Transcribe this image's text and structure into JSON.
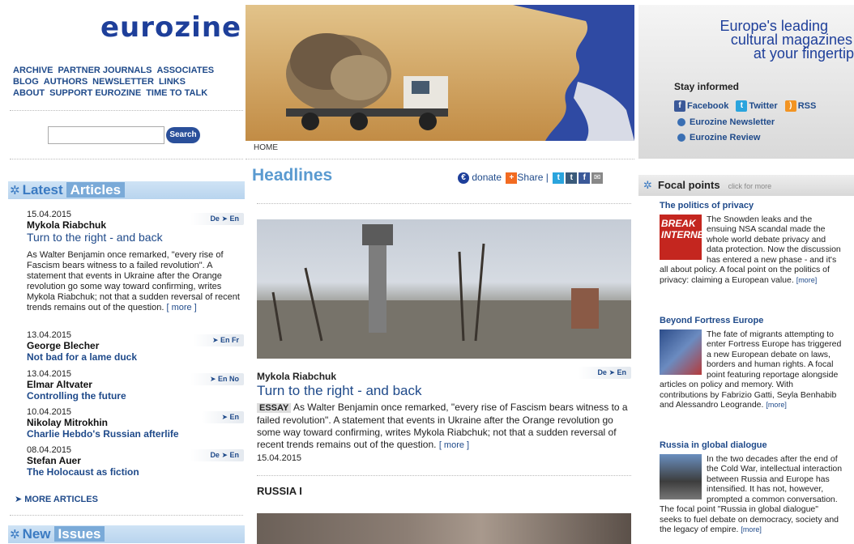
{
  "logo": "eurozine",
  "topnav": [
    "ARCHIVE",
    "PARTNER JOURNALS",
    "ASSOCIATES",
    "BLOG",
    "AUTHORS",
    "NEWSLETTER",
    "LINKS",
    "ABOUT",
    "SUPPORT EUROZINE",
    "TIME TO TALK"
  ],
  "search": {
    "button": "Search"
  },
  "latest": {
    "label1": "Latest",
    "label2": "Articles"
  },
  "articles": [
    {
      "date": "15.04.2015",
      "author": "Mykola Riabchuk",
      "title": "Turn to the right - and back",
      "langs": "De ➤ En",
      "body": "As Walter Benjamin once remarked, \"every rise of Fascism bears witness to a failed revolution\". A statement that events in Ukraine after the Orange revolution go some way toward confirming, writes Mykola Riabchuk; not that a sudden reversal of recent trends remains out of the question.",
      "more": "[ more ]"
    },
    {
      "date": "13.04.2015",
      "author": "George Blecher",
      "title": "Not bad for a lame duck",
      "langs": "➤ En  Fr"
    },
    {
      "date": "13.04.2015",
      "author": "Elmar Altvater",
      "title": "Controlling the future",
      "langs": "➤ En  No"
    },
    {
      "date": "10.04.2015",
      "author": "Nikolay Mitrokhin",
      "title": "Charlie Hebdo's Russian afterlife",
      "langs": "➤ En"
    },
    {
      "date": "08.04.2015",
      "author": "Stefan Auer",
      "title": "The Holocaust as fiction",
      "langs": "De ➤ En"
    }
  ],
  "more_articles": "➤  MORE ARTICLES",
  "new_issues": {
    "label1": "New",
    "label2": "Issues"
  },
  "home": "HOME",
  "headlines": "Headlines",
  "share": {
    "donate": "donate",
    "share": "Share",
    "sep": "|"
  },
  "featured": {
    "author": "Mykola Riabchuk",
    "langs": "De ➤ En",
    "title": "Turn to the right - and back",
    "tag": "ESSAY",
    "body": "As Walter Benjamin once remarked, \"every rise of Fascism bears witness to a failed revolution\". A statement that events in Ukraine after the Orange revolution go some way toward confirming, writes Mykola Riabchuk; not that a sudden reversal of recent trends remains out of the question.",
    "more": "[ more ]",
    "date": "15.04.2015"
  },
  "section": "RUSSIA I",
  "promo": {
    "line1": "Europe's leading",
    "line2": "cultural magazines",
    "line3": "at your fingertip",
    "stay": "Stay informed",
    "facebook": "Facebook",
    "twitter": "Twitter",
    "rss": "RSS",
    "newsletter": "Eurozine Newsletter",
    "review": "Eurozine Review"
  },
  "focal": {
    "title": "Focal points",
    "hint": "click for more",
    "items": [
      {
        "title": "The politics of privacy",
        "body": "The Snowden leaks and the ensuing NSA scandal made the whole world debate privacy and data protection. Now the discussion has entered a new phase - and it's all about policy. A focal point on the politics of privacy: claiming a European value.",
        "more": "[more]",
        "thumb": "BREAK INTERNET"
      },
      {
        "title": "Beyond Fortress Europe",
        "body": "The fate of migrants attempting to enter Fortress Europe has triggered a new European debate on laws, borders and human rights. A focal point featuring reportage alongside articles on policy and memory. With contributions by Fabrizio Gatti, Seyla Benhabib and Alessandro Leogrande.",
        "more": "[more]"
      },
      {
        "title": "Russia in global dialogue",
        "body": "In the two decades after the end of the Cold War, intellectual interaction between Russia and Europe has intensified. It has not, however, prompted a common conversation. The focal point \"Russia in global dialogue\" seeks to fuel debate on democracy, society and the legacy of empire.",
        "more": "[more]"
      }
    ]
  }
}
